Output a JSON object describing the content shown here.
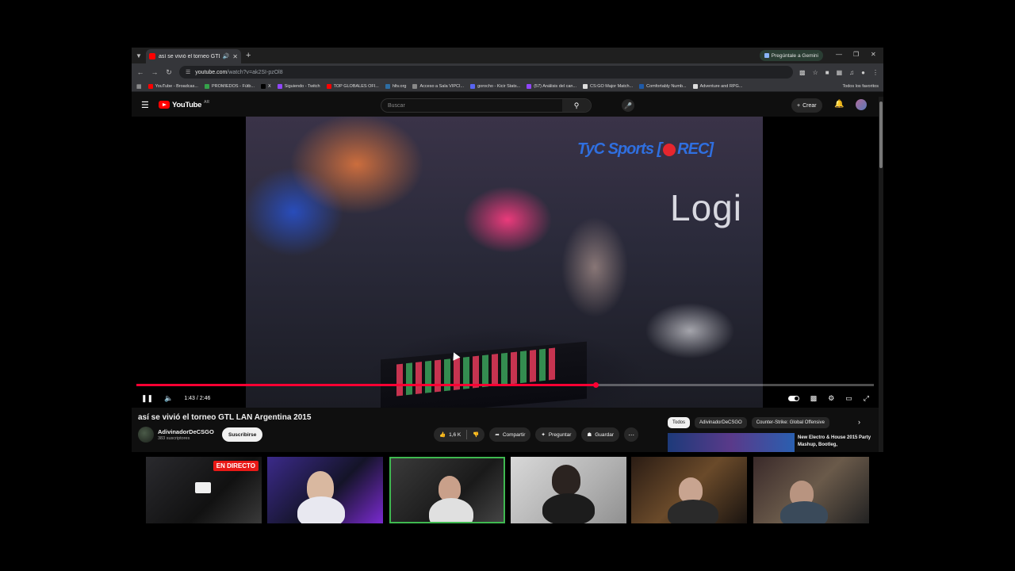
{
  "browser": {
    "tab_title": "así se vivió el torneo GTL LAN Argentina 2015",
    "gemini_label": "Pregúntale a Gemini",
    "url_host": "youtube.com",
    "url_path": "/watch?v=ak2SI-pzOl8",
    "bookmarks": [
      {
        "label": "YouTube - Broadcas...",
        "color": "#ff0000"
      },
      {
        "label": "PROMIEDOS - Fútb...",
        "color": "#35a24a"
      },
      {
        "label": "X",
        "color": "#000000"
      },
      {
        "label": "Siguiendo - Twitch",
        "color": "#9146ff"
      },
      {
        "label": "TOP GLOBALES OFI...",
        "color": "#ff0000"
      },
      {
        "label": "hltv.org",
        "color": "#2d6da3"
      },
      {
        "label": "Acceso a Sala VIPCI...",
        "color": "#888888"
      },
      {
        "label": "gorocho - Kicir Stats...",
        "color": "#5865f2"
      },
      {
        "label": "(57) Análisis del can...",
        "color": "#9146ff"
      },
      {
        "label": "CS:GO Major Match...",
        "color": "#dddddd"
      },
      {
        "label": "Comfortably Numb...",
        "color": "#1e5aa8"
      },
      {
        "label": "Adventure and RPG...",
        "color": "#dddddd"
      }
    ],
    "all_bookmarks": "Todos los favoritos"
  },
  "youtube": {
    "logo": "YouTube",
    "country": "AR",
    "search_placeholder": "Buscar",
    "create_label": "Crear"
  },
  "player": {
    "overlay_brand": "TyC Sports",
    "overlay_rec": "REC",
    "overlay_logo": "Logi",
    "time_display": "1:43 / 2:46",
    "progress": 0.623
  },
  "video": {
    "title": "así se vivió el torneo GTL LAN Argentina 2015",
    "channel": "AdivinadorDeCSGO",
    "subscribers": "383 suscriptores",
    "subscribe_label": "Suscribirse",
    "likes": "1,6 K",
    "share_label": "Compartir",
    "ask_label": "Preguntar",
    "save_label": "Guardar"
  },
  "sidebar": {
    "chips": [
      "Todos",
      "AdivinadorDeCSGO",
      "Counter-Strike: Global Offensive"
    ],
    "rec_title": "New Electro & House 2015 Party Mashup, Bootleg,"
  },
  "stream": {
    "live_label": "EN DIRECTO"
  },
  "colors": {
    "yt_red": "#ff0000",
    "progress_red": "#ff0033",
    "live_red": "#e91916",
    "active_cam": "#3fb950"
  }
}
